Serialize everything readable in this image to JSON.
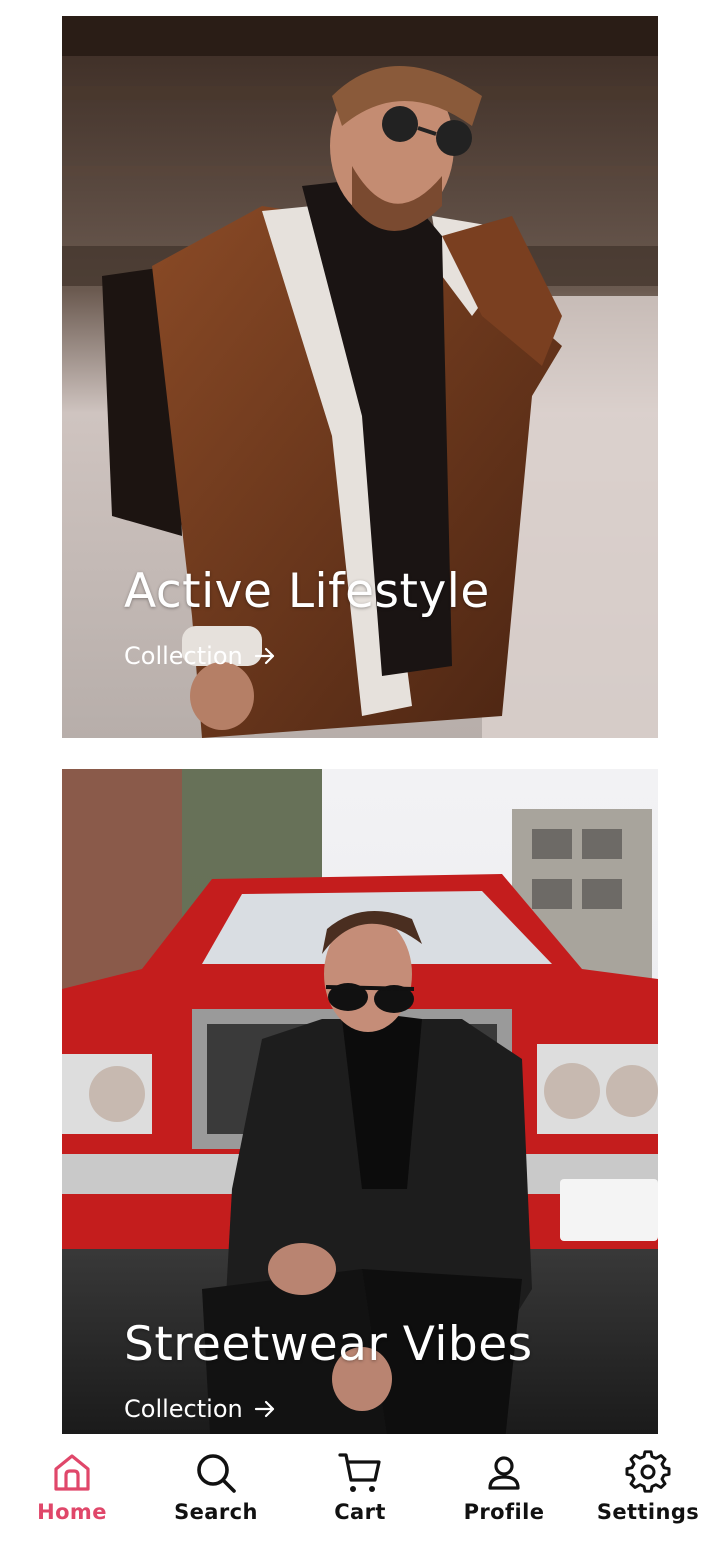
{
  "colors": {
    "accent": "#e0476a",
    "nav_text": "#111111",
    "overlay_text": "#ffffff"
  },
  "collections": [
    {
      "title": "Active Lifestyle",
      "link_label": "Collection"
    },
    {
      "title": "Streetwear Vibes",
      "link_label": "Collection"
    }
  ],
  "bottom_nav": {
    "active": "home",
    "items": [
      {
        "id": "home",
        "label": "Home",
        "icon": "home-icon"
      },
      {
        "id": "search",
        "label": "Search",
        "icon": "search-icon"
      },
      {
        "id": "cart",
        "label": "Cart",
        "icon": "cart-icon"
      },
      {
        "id": "profile",
        "label": "Profile",
        "icon": "profile-icon"
      },
      {
        "id": "settings",
        "label": "Settings",
        "icon": "gear-icon"
      }
    ]
  }
}
